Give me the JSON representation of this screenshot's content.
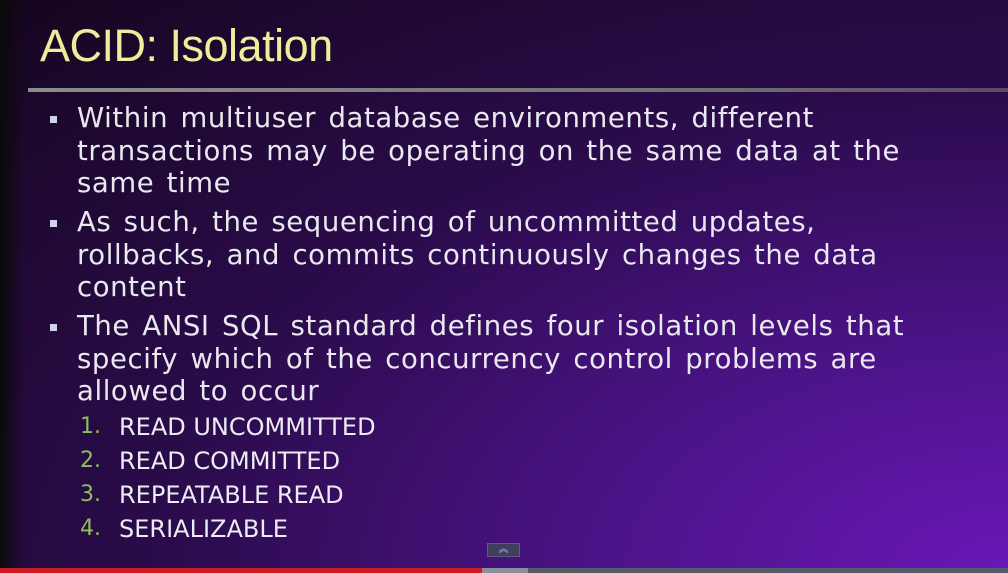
{
  "slide": {
    "title": "ACID: Isolation",
    "bullets": [
      "Within multiuser database environments, different transactions may be operating on the same data at the same time",
      "As such, the sequencing of uncommitted updates, rollbacks, and commits continuously changes the data content",
      "The ANSI SQL standard defines four isolation levels that specify which of the concurrency control problems are allowed to occur"
    ],
    "isolation_levels": [
      {
        "index": "1.",
        "label": "READ UNCOMMITTED"
      },
      {
        "index": "2.",
        "label": "READ COMMITTED"
      },
      {
        "index": "3.",
        "label": "REPEATABLE READ"
      },
      {
        "index": "4.",
        "label": "SERIALIZABLE"
      }
    ]
  },
  "player": {
    "expand_glyph": "︽",
    "progress_played_fraction": 0.478,
    "progress_buffered_fraction": 0.524
  },
  "colors": {
    "title": "#eded9a",
    "text": "#e8e8ee",
    "list_number": "#8fbf5c",
    "progress_played": "#cc1a21"
  }
}
